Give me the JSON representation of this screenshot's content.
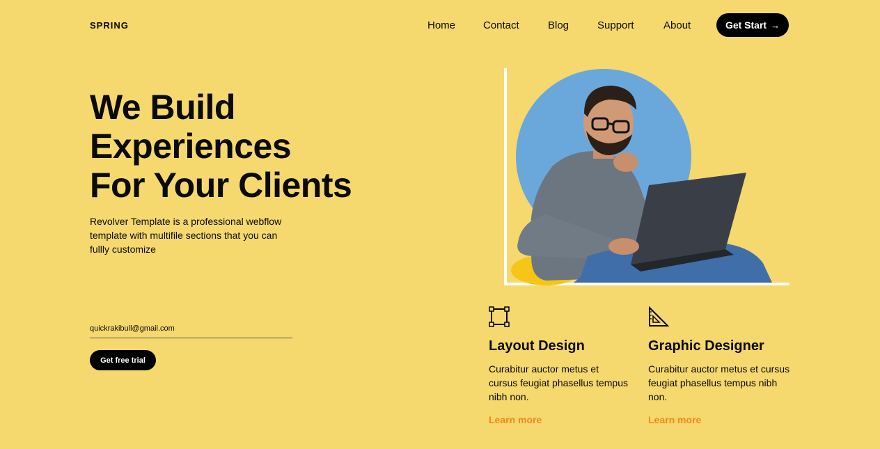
{
  "brand": {
    "logo_text": "SPRING"
  },
  "nav": {
    "items": [
      "Home",
      "Contact",
      "Blog",
      "Support",
      "About"
    ],
    "cta_label": "Get Start",
    "cta_icon": "arrow-right-icon"
  },
  "hero": {
    "title_lines": [
      "We Build",
      "Experiences",
      "For Your Clients"
    ],
    "description": "Revolver Template is a professional webflow template with multifile sections that you can fullly customize",
    "email_value": "quickrakibull@gmail.com",
    "trial_label": "Get free trial",
    "image_alt": "Man with glasses working on a laptop"
  },
  "features": [
    {
      "icon": "crop-frame-icon",
      "title": "Layout Design",
      "text": "Curabitur auctor metus et cursus feugiat phasellus tempus nibh non.",
      "link": "Learn more"
    },
    {
      "icon": "triangle-ruler-icon",
      "title": "Graphic Designer",
      "text": "Curabitur auctor metus et cursus feugiat phasellus tempus nibh non.",
      "link": "Learn more"
    }
  ],
  "colors": {
    "background": "#f5d86e",
    "accent": "#f0891e",
    "dark": "#000000",
    "circle": "#6aa8dc"
  }
}
